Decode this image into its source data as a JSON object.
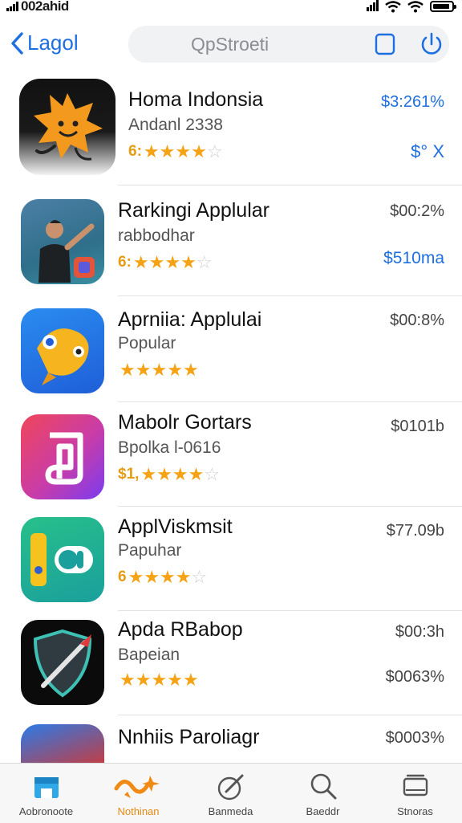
{
  "status_bar": {
    "carrier": "002ahid"
  },
  "nav": {
    "back_label": "Lagol",
    "search_placeholder": "QpStroeti"
  },
  "apps": [
    {
      "name": "Homa Indonsia",
      "subtitle": "Andanl 2338",
      "rating_prefix": "6:",
      "stars": 3.5,
      "price": "$3:261%",
      "price2": "$° X"
    },
    {
      "name": "Rarkingi Applular",
      "subtitle": "rabbodhar",
      "rating_prefix": "6:",
      "stars": 4,
      "price": "$00:2%",
      "price2": "$510ma"
    },
    {
      "name": "Aprniia: Applulai",
      "subtitle": "Popular",
      "rating_prefix": "",
      "stars": 4.5,
      "price": "$00:8%",
      "price2": ""
    },
    {
      "name": "Mabolr Gortars",
      "subtitle": "Bpolka l-0616",
      "rating_prefix": "$1,",
      "stars": 4,
      "price": "$0101b",
      "price2": ""
    },
    {
      "name": "ApplViskmsit",
      "subtitle": "Papuhar",
      "rating_prefix": "6",
      "stars": 4,
      "price": "$77.09b",
      "price2": ""
    },
    {
      "name": "Apda RBabop",
      "subtitle": "Bapeian",
      "rating_prefix": "",
      "stars": 4.5,
      "price": "$00:3h",
      "price2": "$0063%"
    },
    {
      "name": "Nnhiis Paroliagr",
      "subtitle": "",
      "rating_prefix": "",
      "stars": 0,
      "price": "$0003%",
      "price2": ""
    }
  ],
  "tabs": [
    {
      "label": "Aobronoote",
      "icon": "store-icon",
      "active": false
    },
    {
      "label": "Nothinan",
      "icon": "sparkle-icon",
      "active": true
    },
    {
      "label": "Banmeda",
      "icon": "pencil-icon",
      "active": false
    },
    {
      "label": "Baeddr",
      "icon": "search-icon",
      "active": false
    },
    {
      "label": "Stnoras",
      "icon": "stack-icon",
      "active": false
    }
  ],
  "colors": {
    "accent": "#1e6fe0",
    "star": "#f5a214",
    "active_tab": "#e58a10"
  }
}
